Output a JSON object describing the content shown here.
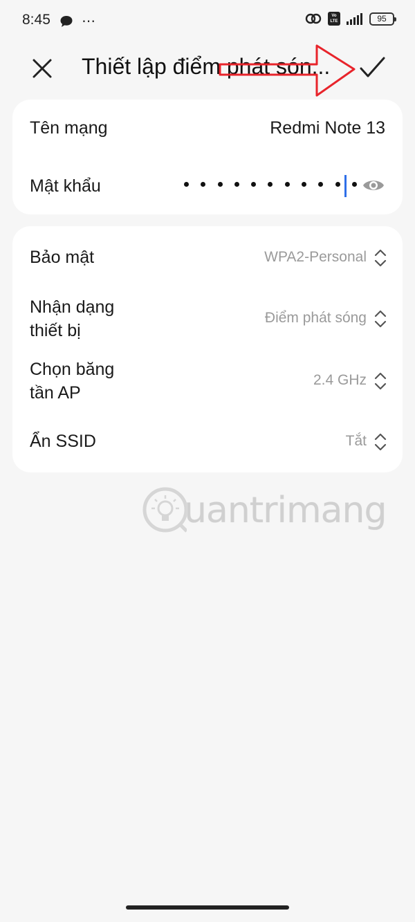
{
  "status_bar": {
    "time": "8:45",
    "more": "⋯",
    "volte": "Vo LTE",
    "battery": "95"
  },
  "header": {
    "title": "Thiết lập điểm phát són...",
    "close_icon": "close-icon",
    "confirm_icon": "check-icon"
  },
  "network": {
    "name_label": "Tên mạng",
    "name_value": "Redmi Note 13",
    "password_label": "Mật khẩu",
    "password_dot_count": 11,
    "eye_icon": "eye-icon"
  },
  "settings": {
    "rows": [
      {
        "label": "Bảo mật",
        "value": "WPA2-Personal"
      },
      {
        "label_line1": "Nhận dạng",
        "label_line2": "thiết bị",
        "value": "Điểm phát sóng"
      },
      {
        "label_line1": "Chọn băng",
        "label_line2": "tần AP",
        "value": "2.4 GHz"
      },
      {
        "label": "Ẩn SSID",
        "value": "Tắt"
      }
    ]
  },
  "watermark": {
    "text": "uantrimang"
  },
  "colors": {
    "background": "#f6f6f6",
    "card": "#ffffff",
    "accent_cursor": "#2f6fe8",
    "annotation_arrow": "#e8242b",
    "secondary_text": "#9a9a9a"
  }
}
